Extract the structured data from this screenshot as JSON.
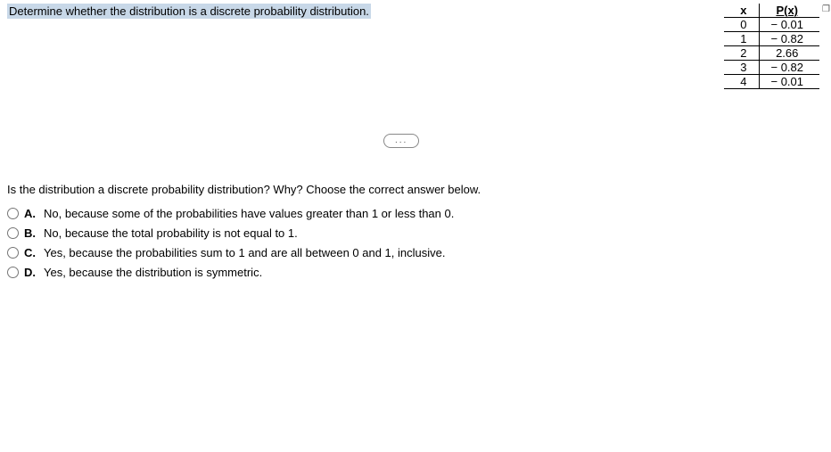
{
  "title": "Determine whether the distribution is a discrete probability distribution.",
  "table": {
    "header_x": "x",
    "header_px": "P(x)",
    "rows": [
      {
        "x": "0",
        "px": "− 0.01"
      },
      {
        "x": "1",
        "px": "− 0.82"
      },
      {
        "x": "2",
        "px": "2.66"
      },
      {
        "x": "3",
        "px": "− 0.82"
      },
      {
        "x": "4",
        "px": "− 0.01"
      }
    ]
  },
  "ellipsis": "...",
  "subquestion": "Is the distribution a discrete probability distribution? Why? Choose the correct answer below.",
  "options": [
    {
      "letter": "A.",
      "text": "No, because some of the probabilities have values greater than 1 or less than 0."
    },
    {
      "letter": "B.",
      "text": "No, because the total probability is not equal to 1."
    },
    {
      "letter": "C.",
      "text": "Yes, because the probabilities sum to 1 and are all between 0 and 1, inclusive."
    },
    {
      "letter": "D.",
      "text": "Yes, because the distribution is symmetric."
    }
  ],
  "popup_glyph": "❐"
}
